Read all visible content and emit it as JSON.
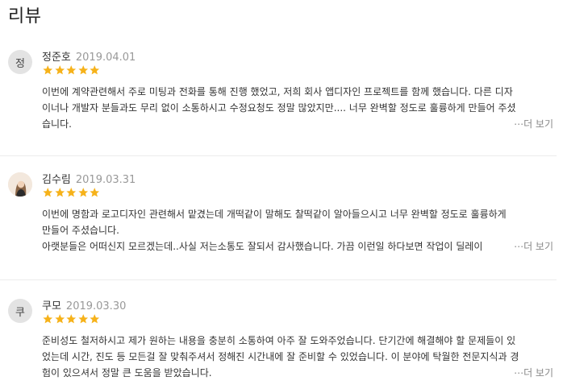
{
  "section": {
    "title": "리뷰"
  },
  "colors": {
    "star": "#f6b21a",
    "date": "#999999",
    "more": "#888888"
  },
  "reviews": [
    {
      "avatar_initial": "정",
      "name": "정준호",
      "date": "2019.04.01",
      "rating": 5,
      "lines": [
        "이번에 계약관련해서 주로 미팅과 전화를 통해 진행 했었고, 저희 회사 앱디자인 프로젝트를 함께 했습니다. 다른 디자",
        "이너나 개발자 분들과도 무리 없이 소통하시고 수정요청도 정말 많았지만.... 너무 완벽할 정도로 훌륭하게 만들어 주셨",
        "습니다."
      ],
      "more_label": "⋯더 보기"
    },
    {
      "avatar_initial": "",
      "name": "김수림",
      "date": "2019.03.31",
      "rating": 5,
      "lines": [
        "이번에 명함과 로고디자인 관련해서 맡겼는데 개떡같이 말해도 찰떡같이 알아들으시고 너무 완벽할 정도로 훌륭하게",
        "만들어 주셨습니다.",
        "아랫분들은 어떠신지 모르겠는데..사실 저는소통도 잘되서 감사했습니다. 가끔 이런일 하다보면 작업이 딜레이"
      ],
      "more_label": "⋯더 보기"
    },
    {
      "avatar_initial": "쿠",
      "name": "쿠모",
      "date": "2019.03.30",
      "rating": 5,
      "lines": [
        "준비성도 철저하시고 제가 원하는 내용을 충분히 소통하여 아주 잘 도와주었습니다. 단기간에 해결해야 할 문제들이 있",
        "었는데 시간, 진도 등 모든걸 잘 맞춰주셔서 정해진 시간내에 잘 준비할 수 있었습니다. 이 분야에 탁월한 전문지식과 경",
        "험이 있으셔서 정말 큰 도움을 받았습니다."
      ],
      "more_label": "⋯더 보기"
    }
  ]
}
